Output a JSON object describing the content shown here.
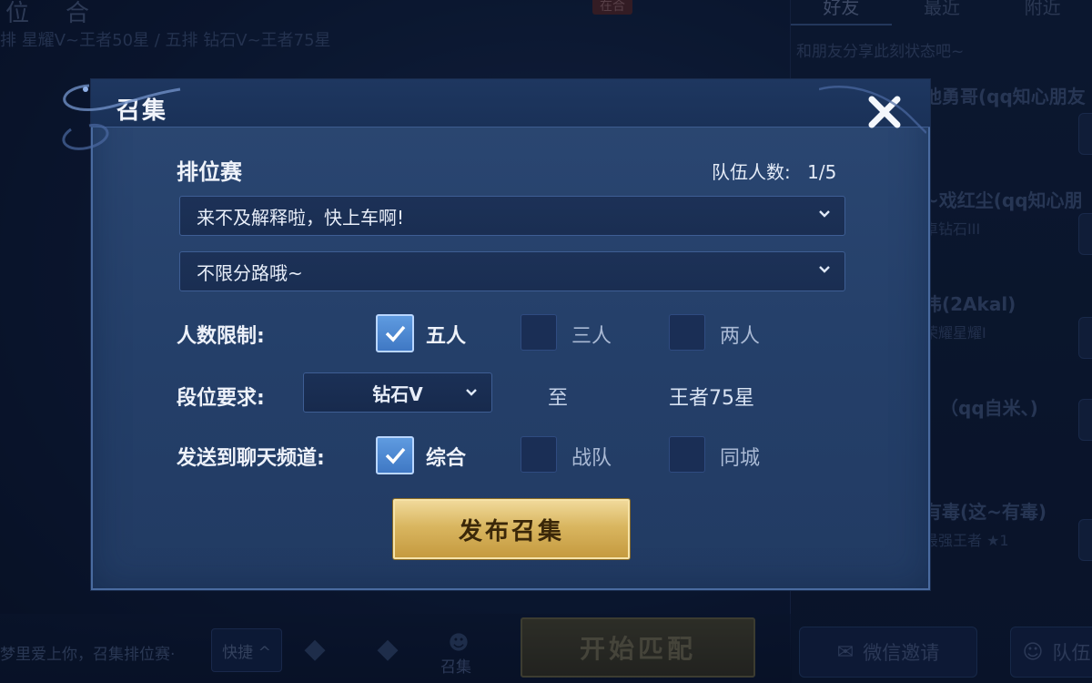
{
  "background": {
    "top_nav": [
      "位",
      "合"
    ],
    "top_badge": "在合",
    "rank_line": "排 星耀V~王者50星 / 五排 钻石V~王者75星",
    "right_panel": {
      "tabs": [
        "好友",
        "最近",
        "附近"
      ],
      "share_hint": "和朋友分享此刻状态吧~",
      "friends": [
        {
          "name": "他勇哥(qq知心朋友",
          "sub": ""
        },
        {
          "name": "~戏红尘(qq知心朋",
          "sub": "卓钻石III"
        },
        {
          "name": "伟(2Akal)",
          "sub": "荣耀星耀I"
        },
        {
          "name": "（qq自米、)",
          "sub": ""
        },
        {
          "name": "有毒(这~有毒)",
          "sub": "最强王者 ★1"
        }
      ]
    },
    "bottom": {
      "chat_text": "梦里爱上你，召集排位赛·",
      "quick_label": "快捷 ^",
      "gather_label": "召集",
      "start_label": "开始匹配",
      "wechat_invite": "微信邀请",
      "team_label": "队伍"
    }
  },
  "modal": {
    "title": "召集",
    "mode": "排位赛",
    "team_count_label": "队伍人数:",
    "team_count_value": "1/5",
    "message_select": "来不及解释啦，快上车啊!",
    "lane_select": "不限分路哦~",
    "size_limit": {
      "label": "人数限制:",
      "options": [
        {
          "label": "五人",
          "checked": true
        },
        {
          "label": "三人",
          "checked": false
        },
        {
          "label": "两人",
          "checked": false
        }
      ]
    },
    "rank_requirement": {
      "label": "段位要求:",
      "min": "钻石V",
      "to": "至",
      "max": "王者75星"
    },
    "send_channel": {
      "label": "发送到聊天频道:",
      "options": [
        {
          "label": "综合",
          "checked": true
        },
        {
          "label": "战队",
          "checked": false
        },
        {
          "label": "同城",
          "checked": false
        }
      ]
    },
    "publish_button": "发布召集"
  },
  "colors": {
    "modal_bg": "#2b4772",
    "check_on": "#4a86d2",
    "publish_gold": "#d9b660"
  }
}
